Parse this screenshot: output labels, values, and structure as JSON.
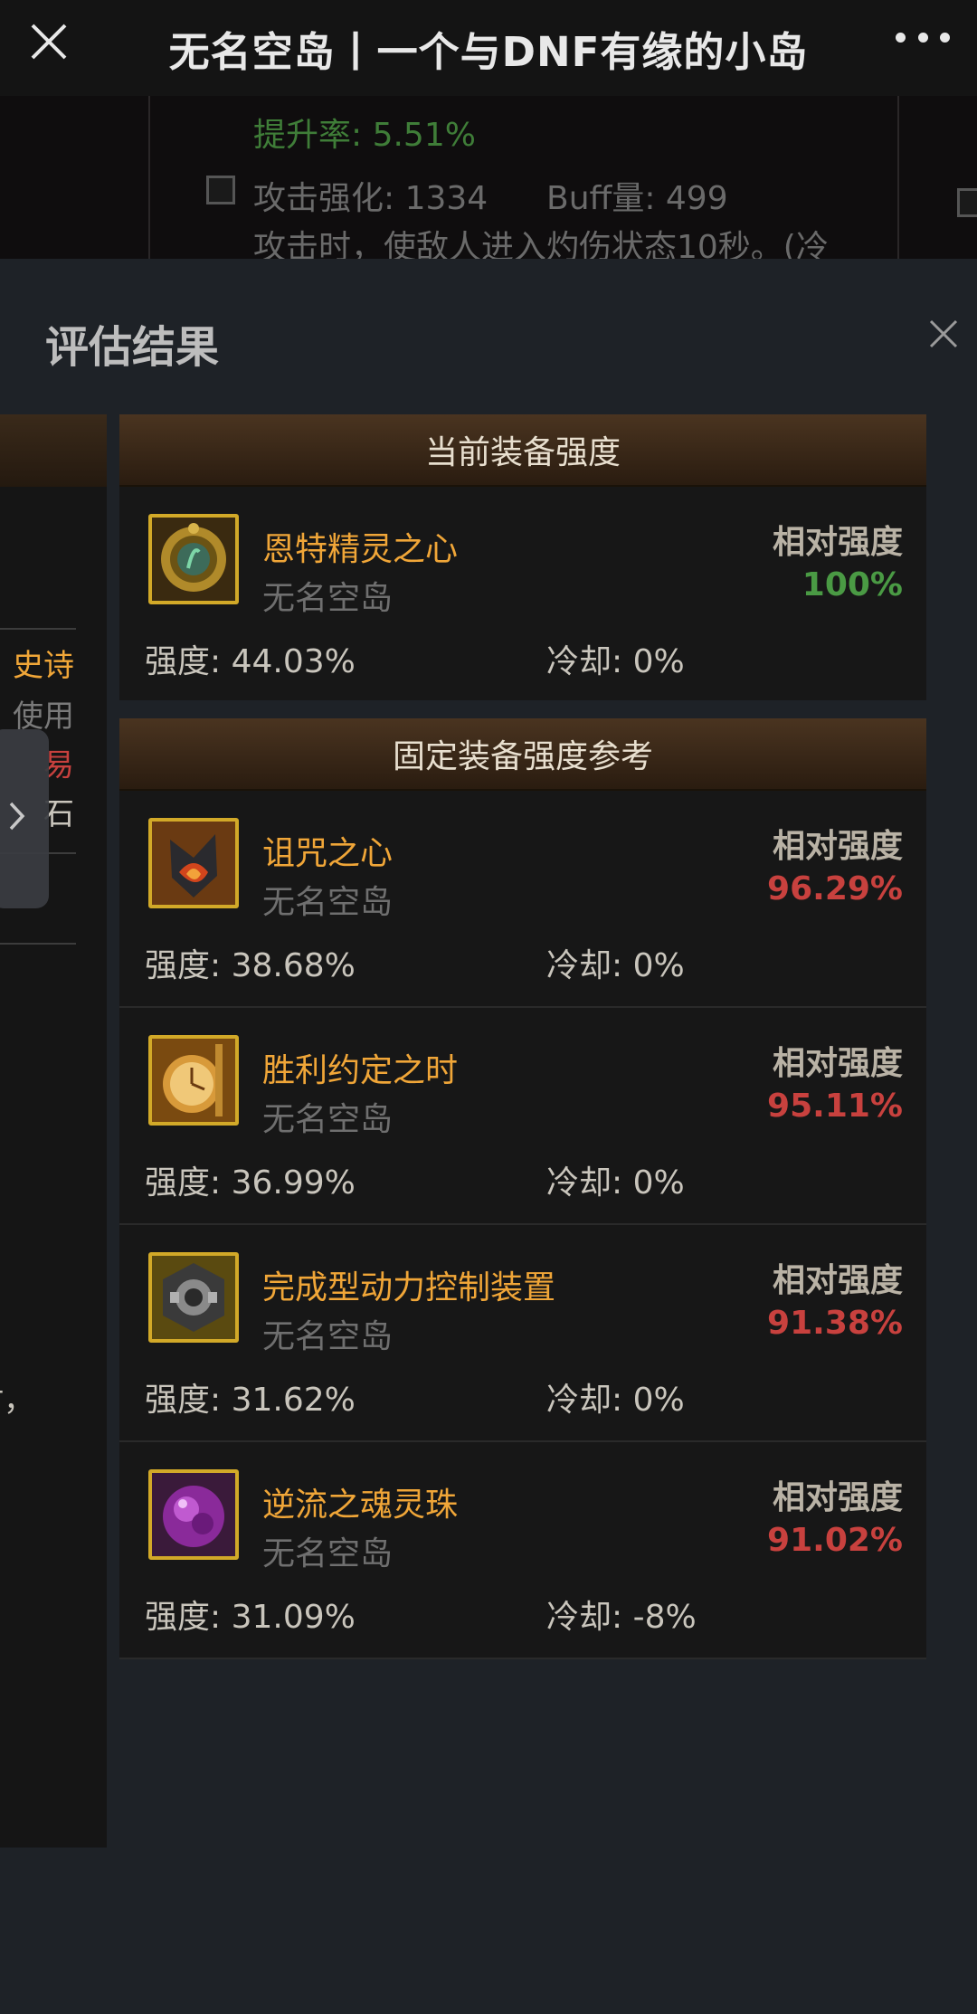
{
  "topbar": {
    "title": "无名空岛丨一个与DNF有缘的小岛"
  },
  "background": {
    "rate_text": "提升率: 5.51%",
    "attack_text": "攻击强化: 1334",
    "buff_text": "Buff量: 499",
    "desc_text": "攻击时，使敌人进入灼伤状态10秒。(冷"
  },
  "modal": {
    "title": "评估结果"
  },
  "left_panel": {
    "items": [
      "史诗",
      "使用",
      "易",
      "石",
      "时，"
    ],
    "item_colors": [
      "#f0a638",
      "#7a7a7a",
      "#c8413e",
      "#c9c5bc",
      "#c9c5bc"
    ]
  },
  "current": {
    "header": "当前装备强度",
    "item": {
      "name": "恩特精灵之心",
      "source": "无名空岛",
      "rel_label": "相对强度",
      "rel_value": "100%",
      "rel_color": "#4a9a44",
      "strength": "强度: 44.03%",
      "cooldown": "冷却: 0%",
      "icon": "entei-spirit-heart-icon"
    }
  },
  "reference": {
    "header": "固定装备强度参考",
    "items": [
      {
        "name": "诅咒之心",
        "source": "无名空岛",
        "rel_label": "相对强度",
        "rel_value": "96.29%",
        "rel_color": "#c8413e",
        "strength": "强度: 38.68%",
        "cooldown": "冷却: 0%",
        "icon": "cursed-heart-icon"
      },
      {
        "name": "胜利约定之时",
        "source": "无名空岛",
        "rel_label": "相对强度",
        "rel_value": "95.11%",
        "rel_color": "#c8413e",
        "strength": "强度: 36.99%",
        "cooldown": "冷却: 0%",
        "icon": "victory-pocket-watch-icon"
      },
      {
        "name": "完成型动力控制装置",
        "source": "无名空岛",
        "rel_label": "相对强度",
        "rel_value": "91.38%",
        "rel_color": "#c8413e",
        "strength": "强度: 31.62%",
        "cooldown": "冷却: 0%",
        "icon": "power-control-device-icon"
      },
      {
        "name": "逆流之魂灵珠",
        "source": "无名空岛",
        "rel_label": "相对强度",
        "rel_value": "91.02%",
        "rel_color": "#c8413e",
        "strength": "强度: 31.09%",
        "cooldown": "冷却: -8%",
        "icon": "countercurrent-soul-orb-icon"
      }
    ]
  }
}
